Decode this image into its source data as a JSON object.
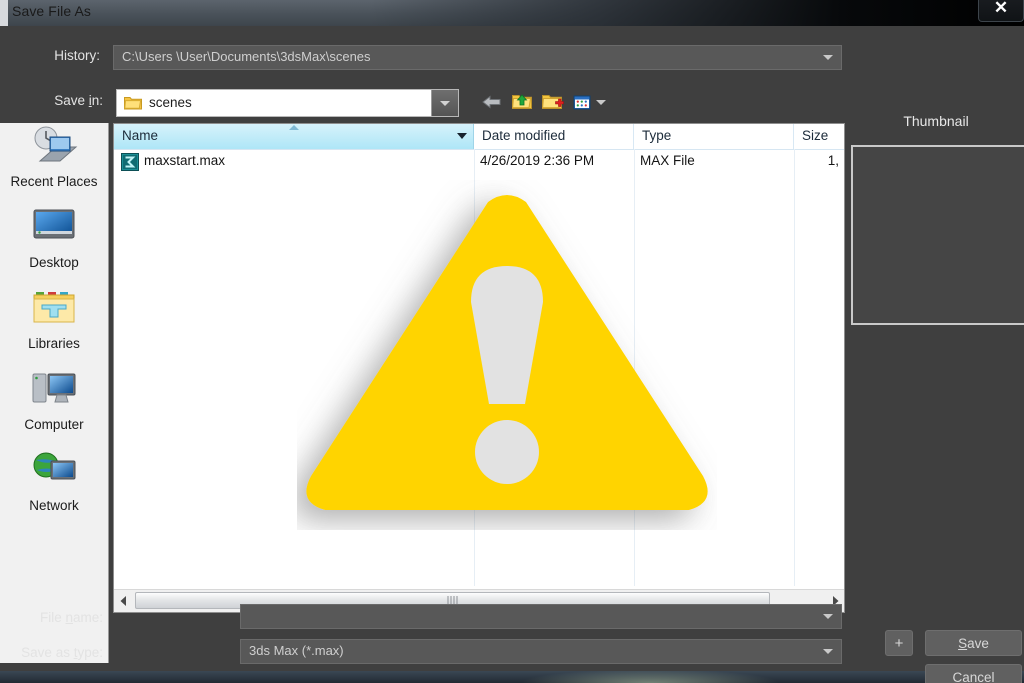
{
  "window": {
    "title": "Save File As",
    "close_label": "✕"
  },
  "toolbar": {
    "history_label": "History:",
    "history_value": "C:\\Users \\User\\Documents\\3dsMax\\scenes",
    "savein_label_pre": "Save ",
    "savein_label_key": "i",
    "savein_label_post": "n:",
    "savein_value": "scenes",
    "icons": {
      "back": "back-arrow-icon",
      "up": "up-one-level-icon",
      "new_folder": "new-folder-icon",
      "views": "views-icon",
      "views_dropdown": "chevron-down-icon"
    }
  },
  "places": {
    "items": [
      {
        "label": "Recent Places",
        "icon": "recent-places-icon"
      },
      {
        "label": "Desktop",
        "icon": "desktop-icon"
      },
      {
        "label": "Libraries",
        "icon": "libraries-icon"
      },
      {
        "label": "Computer",
        "icon": "computer-icon"
      },
      {
        "label": "Network",
        "icon": "network-icon"
      }
    ]
  },
  "filelist": {
    "columns": [
      {
        "label": "Name",
        "sorted": true
      },
      {
        "label": "Date modified",
        "sorted": false
      },
      {
        "label": "Type",
        "sorted": false
      },
      {
        "label": "Size",
        "sorted": false
      }
    ],
    "rows": [
      {
        "name": "maxstart.max",
        "date_modified": "4/26/2019 2:36 PM",
        "type": "MAX File",
        "size": "1,",
        "icon": "max-file-icon"
      }
    ],
    "scrollbar": {
      "left_arrow": "◀",
      "right_arrow": "▶"
    }
  },
  "thumbnail": {
    "title": "Thumbnail"
  },
  "footer": {
    "filename_label_pre": "File ",
    "filename_label_key": "n",
    "filename_label_post": "ame:",
    "filename_value": "",
    "filetype_label_pre": "Save as ",
    "filetype_label_key": "t",
    "filetype_label_post": "ype:",
    "filetype_value": "3ds Max (*.max)",
    "plus_label": "+",
    "save_label_pre": "",
    "save_label_key": "S",
    "save_label_post": "ave",
    "cancel_label": "Cancel"
  },
  "overlay": {
    "icon": "warning-triangle-icon",
    "color": "#FFD400",
    "glyph_color": "#E4E4E4"
  }
}
